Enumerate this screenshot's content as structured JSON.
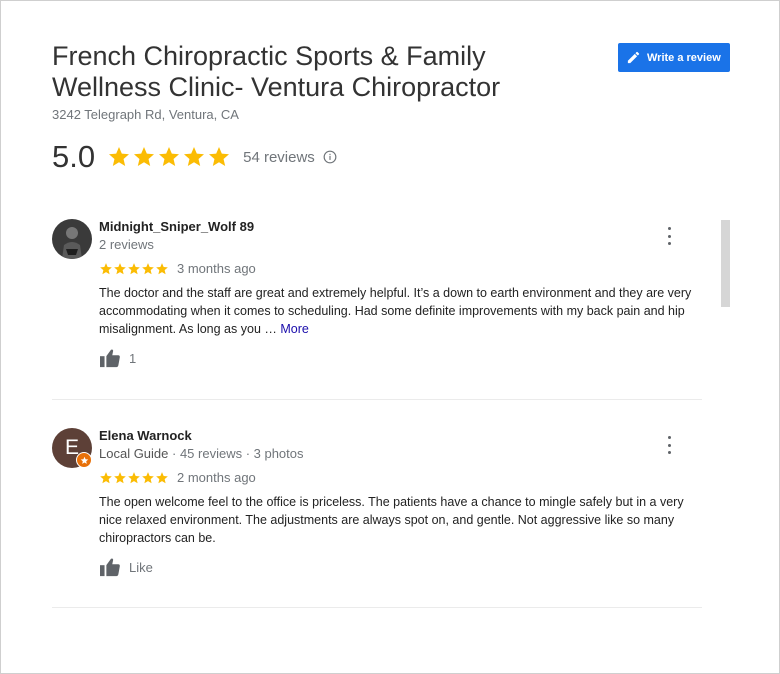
{
  "business": {
    "name": "French Chiropractic Sports & Family Wellness Clinic- Ventura Chiropractor",
    "address": "3242 Telegraph Rd, Ventura, CA",
    "rating": "5.0",
    "stars": 5,
    "reviews_count": "54 reviews"
  },
  "actions": {
    "write_review": "Write a review"
  },
  "colors": {
    "accent": "#1a73e8",
    "star": "#fbbc04",
    "link": "#1a0dab",
    "badge": "#e8710a"
  },
  "reviews": [
    {
      "name": "Midnight_Sniper_Wolf 89",
      "meta": "2 reviews",
      "local_guide": "",
      "stars": 5,
      "time": "3 months ago",
      "text": "The doctor and the staff are great and extremely helpful. It’s a down to earth environment and they are very accommodating when it comes to scheduling. Had some definite improvements with my back pain and hip misalignment. As long as you … ",
      "more": "More",
      "likes": "1"
    },
    {
      "name": "Elena Warnock",
      "avatar_letter": "E",
      "local_guide": "Local Guide",
      "meta": " · 45 reviews · 3 photos",
      "stars": 5,
      "time": "2 months ago",
      "text": "The open welcome feel to the office is priceless. The patients have a chance to mingle safely but in a very nice relaxed environment. The adjustments are always spot on, and gentle. Not aggressive like so many chiropractors can be.",
      "likes": "Like"
    }
  ]
}
